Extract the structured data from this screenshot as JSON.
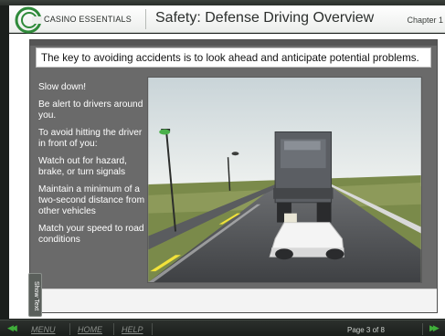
{
  "header": {
    "brand": "CASINO ESSENTIALS",
    "course_title": "Safety: Defense Driving Overview",
    "chapter": "Chapter 1"
  },
  "slide": {
    "headline": "The key to avoiding accidents is to look ahead and anticipate potential problems.",
    "bullets": [
      "Slow down!",
      "Be alert to drivers around you.",
      "To avoid hitting the driver in front of you:",
      "Watch out for hazard, brake, or turn signals",
      "Maintain a minimum of a two-second distance from other vehicles",
      "Match your speed to road conditions"
    ]
  },
  "show_text_tab": {
    "label": "Show Text"
  },
  "navbar": {
    "menu_label": "MENU",
    "home_label": "HOME",
    "help_label": "HELP",
    "page_indicator": "Page 3 of 8"
  },
  "colors": {
    "brand_green": "#3fae3a",
    "slide_gray": "#6a6a6a",
    "navbar_dark": "#1b1f1c"
  },
  "icons": {
    "logo": "casino-essentials-logo",
    "prev": "double-chevron-left-icon",
    "next": "double-chevron-right-icon"
  }
}
